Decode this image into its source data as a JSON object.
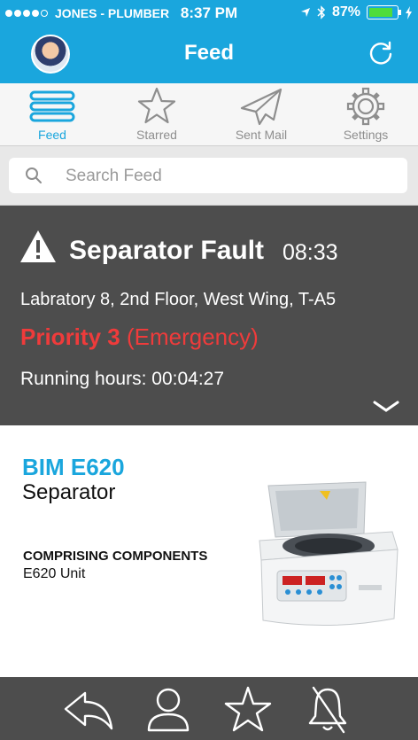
{
  "status_bar": {
    "carrier": "JONES - PLUMBER",
    "time": "8:37 PM",
    "battery": "87%",
    "battery_level": 0.87
  },
  "nav": {
    "title": "Feed"
  },
  "tabs": [
    {
      "label": "Feed",
      "icon": "list-icon",
      "active": true
    },
    {
      "label": "Starred",
      "icon": "star-icon"
    },
    {
      "label": "Sent Mail",
      "icon": "paper-plane-icon"
    },
    {
      "label": "Settings",
      "icon": "gear-icon"
    }
  ],
  "search": {
    "placeholder": "Search Feed"
  },
  "alert": {
    "title": "Separator Fault",
    "time": "08:33",
    "location": "Labratory 8, 2nd Floor, West Wing, T-A5",
    "priority": "Priority 3",
    "priority_level": "(Emergency)",
    "running_hours_label": "Running hours:",
    "running_hours_value": "00:04:27"
  },
  "product": {
    "name": "BIM E620",
    "type": "Separator",
    "components_heading": "COMPRISING COMPONENTS",
    "components_value": "E620 Unit"
  },
  "bottom_bar": {
    "icons": [
      "reply-icon",
      "user-icon",
      "star-icon",
      "bell-off-icon"
    ]
  },
  "colors": {
    "brand": "#1aa6dd",
    "dark_panel": "#4d4d4d",
    "priority_red": "#ef3b3b"
  }
}
